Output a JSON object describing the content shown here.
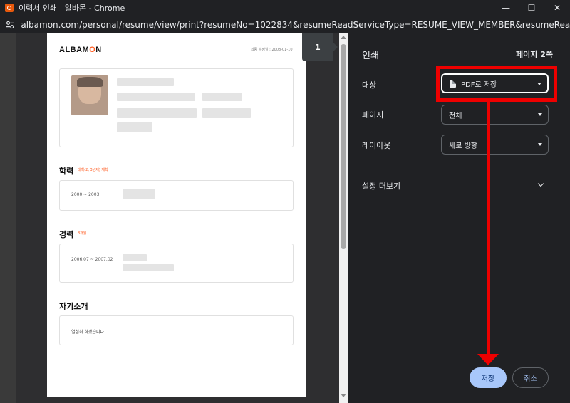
{
  "window": {
    "title": "이력서 인쇄 | 알바몬 - Chrome",
    "url": "albamon.com/personal/resume/view/print?resumeNo=1022834&resumeReadServiceType=RESUME_VIEW_MEMBER&resumeReadSubType=PRINT",
    "controls": {
      "minimize": "—",
      "maximize": "☐",
      "close": "✕"
    }
  },
  "preview": {
    "page_number": "1",
    "logo_prefix": "ALBAM",
    "logo_o": "O",
    "logo_suffix": "N",
    "updated_date": "최종 수정일 : 2008-01-10",
    "education": {
      "title": "학력",
      "sub": "대학(2, 3년제) 재학",
      "period": "2000 ~ 2003"
    },
    "career": {
      "title": "경력",
      "sub": "8개월",
      "period": "2006.07 ~ 2007.02"
    },
    "intro": {
      "title": "자기소개",
      "text": "열심히 하겠습니다."
    }
  },
  "print_panel": {
    "title": "인쇄",
    "page_count": "페이지 2쪽",
    "destination": {
      "label": "대상",
      "value": "PDF로 저장"
    },
    "pages": {
      "label": "페이지",
      "value": "전체"
    },
    "layout": {
      "label": "레이아웃",
      "value": "세로 방향"
    },
    "more_settings": "설정 더보기",
    "save_button": "저장",
    "cancel_button": "취소"
  },
  "colors": {
    "accent": "#a8c7fa",
    "brand": "#ff5a1f",
    "annotation": "#ee0000"
  }
}
